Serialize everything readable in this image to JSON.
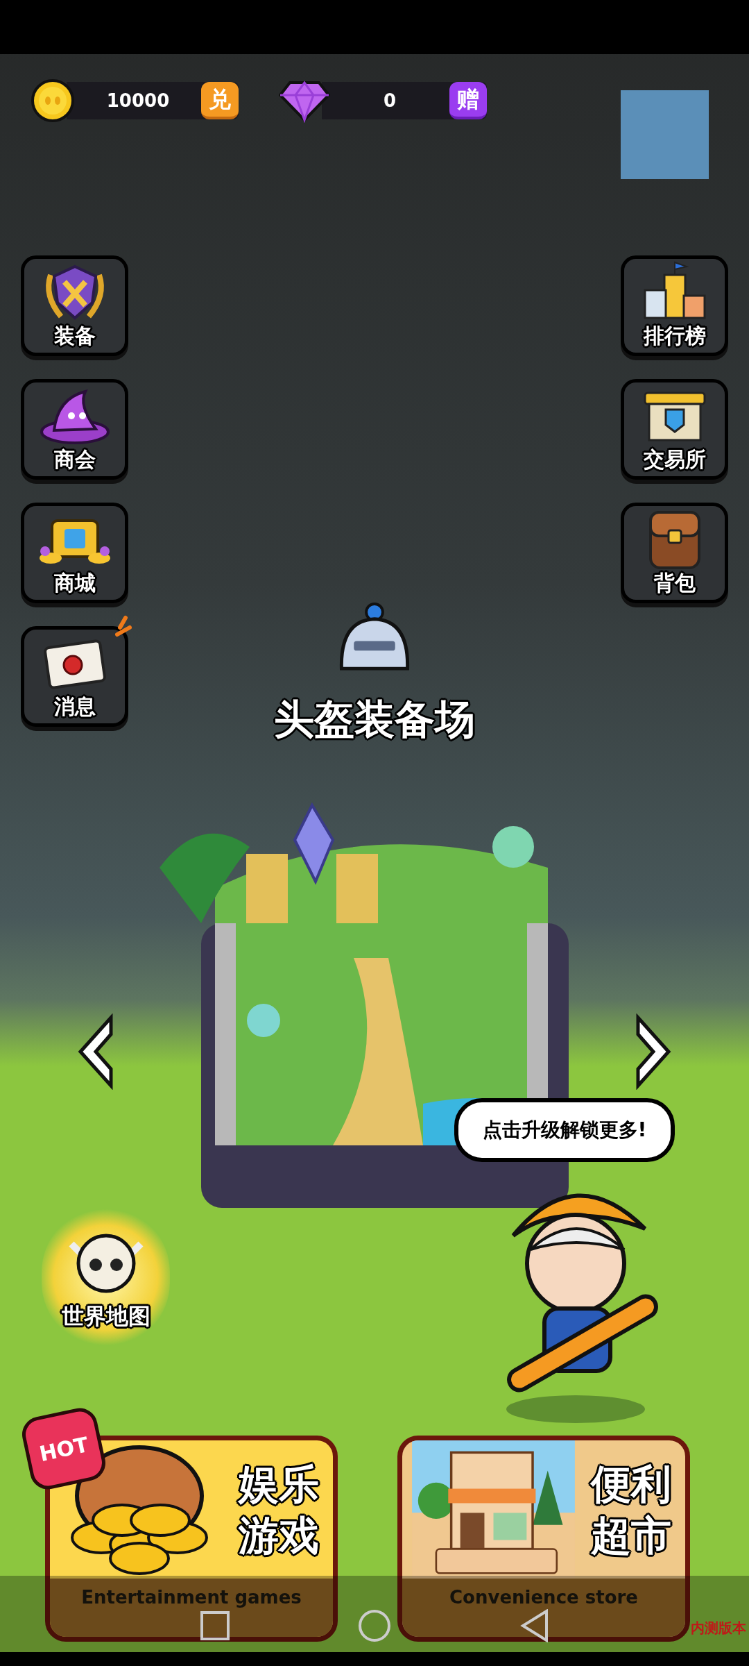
{
  "currencies": [
    {
      "kind": "coin",
      "amount": "10000",
      "action": "兑"
    },
    {
      "kind": "gem",
      "amount": "0",
      "action": "赠"
    }
  ],
  "left_menu": [
    {
      "kind": "equipment",
      "label": "装备",
      "notification": false
    },
    {
      "kind": "guild",
      "label": "商会",
      "notification": false
    },
    {
      "kind": "shop",
      "label": "商城",
      "notification": false
    },
    {
      "kind": "mail",
      "label": "消息",
      "notification": true
    }
  ],
  "right_menu": [
    {
      "kind": "ranking",
      "label": "排行榜",
      "notification": false
    },
    {
      "kind": "exchange",
      "label": "交易所",
      "notification": false
    },
    {
      "kind": "bag",
      "label": "背包",
      "notification": false
    }
  ],
  "arena": {
    "title": "头盔装备场",
    "bubble": "点击升级解锁更多!"
  },
  "world_map": {
    "label": "世界地图"
  },
  "cards": [
    {
      "kind": "games",
      "title_lines": [
        "娱乐",
        "游戏"
      ],
      "subtitle": "Entertainment games",
      "hot": true,
      "hot_label": "HOT"
    },
    {
      "kind": "store",
      "title_lines": [
        "便利",
        "超市"
      ],
      "subtitle": "Convenience store",
      "hot": false
    }
  ],
  "build_label": "内测版本"
}
